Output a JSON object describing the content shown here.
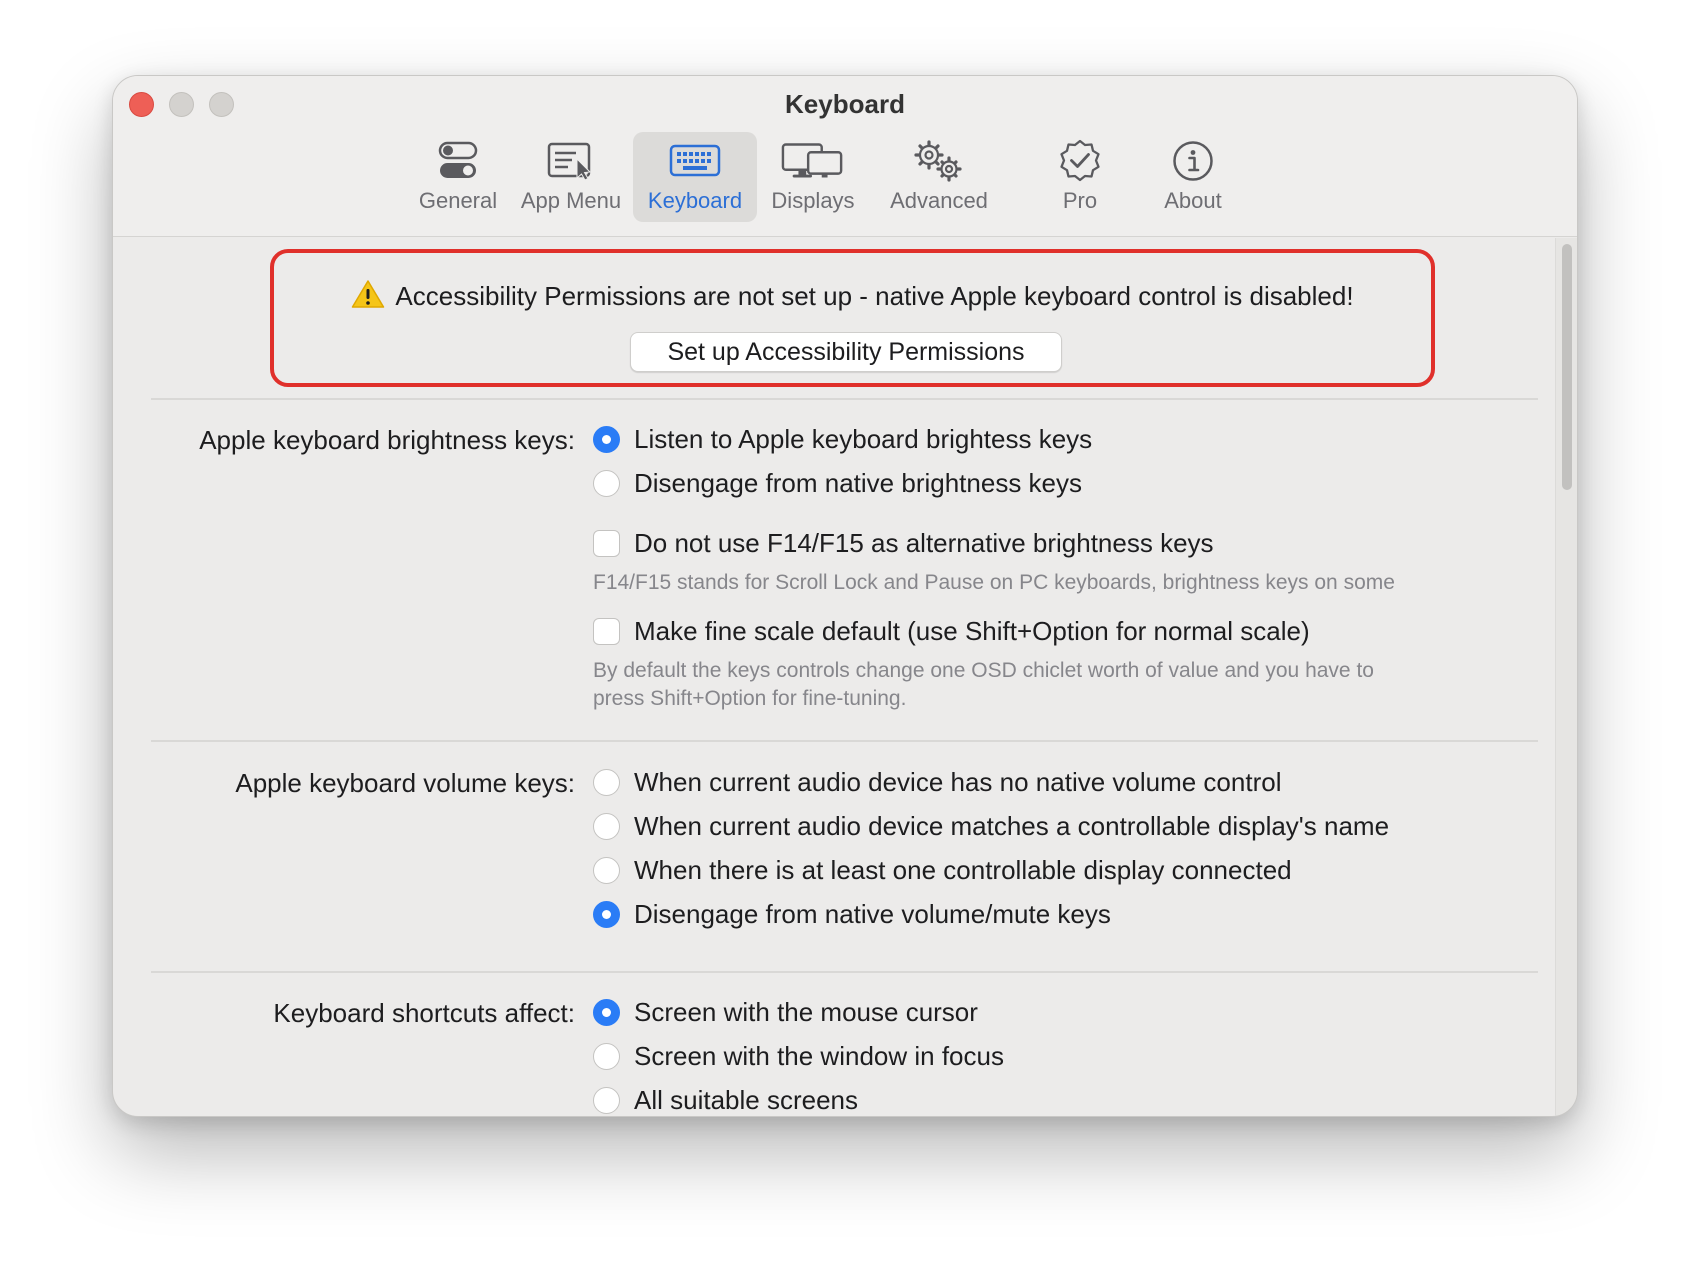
{
  "window": {
    "title": "Keyboard"
  },
  "tabs": [
    {
      "label": "General",
      "icon": "toggle-switches-icon"
    },
    {
      "label": "App Menu",
      "icon": "app-menu-icon"
    },
    {
      "label": "Keyboard",
      "icon": "keyboard-icon",
      "active": true
    },
    {
      "label": "Displays",
      "icon": "displays-icon"
    },
    {
      "label": "Advanced",
      "icon": "gears-icon"
    },
    {
      "label": "Pro",
      "icon": "verified-badge-icon"
    },
    {
      "label": "About",
      "icon": "info-icon"
    }
  ],
  "alert": {
    "message": "Accessibility Permissions are not set up - native Apple keyboard control is disabled!",
    "button_label": "Set up Accessibility Permissions",
    "border_color": "#e0302b"
  },
  "brightness": {
    "label": "Apple keyboard brightness keys:",
    "options": [
      "Listen to Apple keyboard brightess keys",
      "Disengage from native brightness keys"
    ],
    "selected_index": 0,
    "checkbox_f14": "Do not use F14/F15 as alternative brightness keys",
    "checkbox_f14_checked": false,
    "checkbox_f14_help": "F14/F15 stands for Scroll Lock and Pause on PC keyboards, brightness keys on some",
    "checkbox_fine": "Make fine scale default (use Shift+Option for normal scale)",
    "checkbox_fine_checked": false,
    "checkbox_fine_help_1": "By default the keys controls change one OSD chiclet worth of value and you have to",
    "checkbox_fine_help_2": "press Shift+Option for fine-tuning."
  },
  "volume": {
    "label": "Apple keyboard volume keys:",
    "options": [
      "When current audio device has no native volume control",
      "When current audio device matches a controllable display's name",
      "When there is at least one controllable display connected",
      "Disengage from native volume/mute keys"
    ],
    "selected_index": 3
  },
  "shortcuts": {
    "label": "Keyboard shortcuts affect:",
    "options": [
      "Screen with the mouse cursor",
      "Screen with the window in focus",
      "All suitable screens"
    ],
    "selected_index": 0
  },
  "colors": {
    "accent": "#2a7cf6",
    "active_tab_text": "#2c6fd6"
  }
}
